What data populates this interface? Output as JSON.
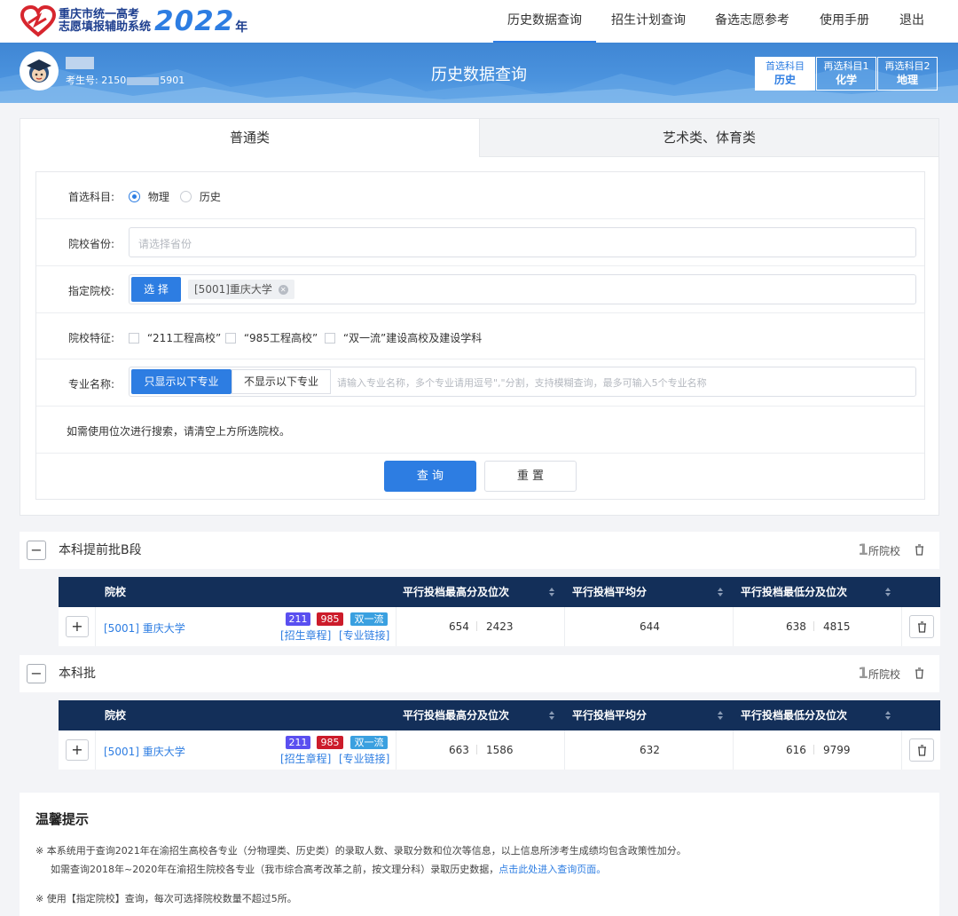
{
  "app": {
    "logo_line1": "重庆市统一高考",
    "logo_line2": "志愿填报辅助系统",
    "logo_year": "2022",
    "logo_nian": "年"
  },
  "nav": {
    "items": [
      {
        "label": "历史数据查询",
        "active": true
      },
      {
        "label": "招生计划查询",
        "active": false
      },
      {
        "label": "备选志愿参考",
        "active": false
      },
      {
        "label": "使用手册",
        "active": false
      },
      {
        "label": "退出",
        "active": false
      }
    ]
  },
  "banner": {
    "title": "历史数据查询",
    "user_id": "考生号: 2150",
    "user_id_tail": "5901",
    "subjects": [
      {
        "label": "首选科目",
        "value": "历史"
      },
      {
        "label": "再选科目1",
        "value": "化学"
      },
      {
        "label": "再选科目2",
        "value": "地理"
      }
    ]
  },
  "tabs": [
    {
      "label": "普通类",
      "active": true
    },
    {
      "label": "艺术类、体育类",
      "active": false
    }
  ],
  "form": {
    "first_subject": {
      "label": "首选科目:",
      "options": [
        "物理",
        "历史"
      ],
      "selected": "物理"
    },
    "province": {
      "label": "院校省份:",
      "placeholder": "请选择省份"
    },
    "school": {
      "label": "指定院校:",
      "select_button": "选 择",
      "selected_tag": "[5001]重庆大学"
    },
    "features": {
      "label": "院校特征:",
      "options": [
        "“211工程高校”",
        "“985工程高校”",
        "“双一流”建设高校及建设学科"
      ]
    },
    "major": {
      "label": "专业名称:",
      "mode_include": "只显示以下专业",
      "mode_exclude": "不显示以下专业",
      "placeholder": "请输入专业名称，多个专业请用逗号\",\"分割，支持模糊查询，最多可输入5个专业名称"
    },
    "rank_note": "如需使用位次进行搜索，请清空上方所选院校。",
    "query_button": "查 询",
    "reset_button": "重 置"
  },
  "sections": [
    {
      "title": "本科提前批B段",
      "count": "1",
      "count_unit": "所院校",
      "columns": [
        "院校",
        "平行投档最高分及位次",
        "平行投档平均分",
        "平行投档最低分及位次"
      ],
      "rows": [
        {
          "school_code": "[5001]",
          "school_name": "重庆大学",
          "badges": [
            "211",
            "985",
            "双一流"
          ],
          "link1": "[招生章程]",
          "link2": "[专业链接]",
          "max_score": "654",
          "max_rank": "2423",
          "avg_score": "644",
          "min_score": "638",
          "min_rank": "4815"
        }
      ]
    },
    {
      "title": "本科批",
      "count": "1",
      "count_unit": "所院校",
      "columns": [
        "院校",
        "平行投档最高分及位次",
        "平行投档平均分",
        "平行投档最低分及位次"
      ],
      "rows": [
        {
          "school_code": "[5001]",
          "school_name": "重庆大学",
          "badges": [
            "211",
            "985",
            "双一流"
          ],
          "link1": "[招生章程]",
          "link2": "[专业链接]",
          "max_score": "663",
          "max_rank": "1586",
          "avg_score": "632",
          "min_score": "616",
          "min_rank": "9799"
        }
      ]
    }
  ],
  "tips": {
    "title": "温馨提示",
    "line1": "※  本系统用于查询2021年在渝招生高校各专业（分物理类、历史类）的录取人数、录取分数和位次等信息，以上信息所涉考生成绩均包含政策性加分。",
    "line2": "如需查询2018年~2020年在渝招生院校各专业（我市综合高考改革之前，按文理分科）录取历史数据，",
    "line2_link": "点击此处进入查询页面。",
    "line3": "※  使用【指定院校】查询，每次可选择院校数量不超过5所。"
  },
  "colors": {
    "primary": "#2d7de2",
    "header_dark": "#132f59",
    "badge_211": "#5a4ff0",
    "badge_985": "#cc1b2a",
    "badge_syl": "#3aa0e0"
  }
}
